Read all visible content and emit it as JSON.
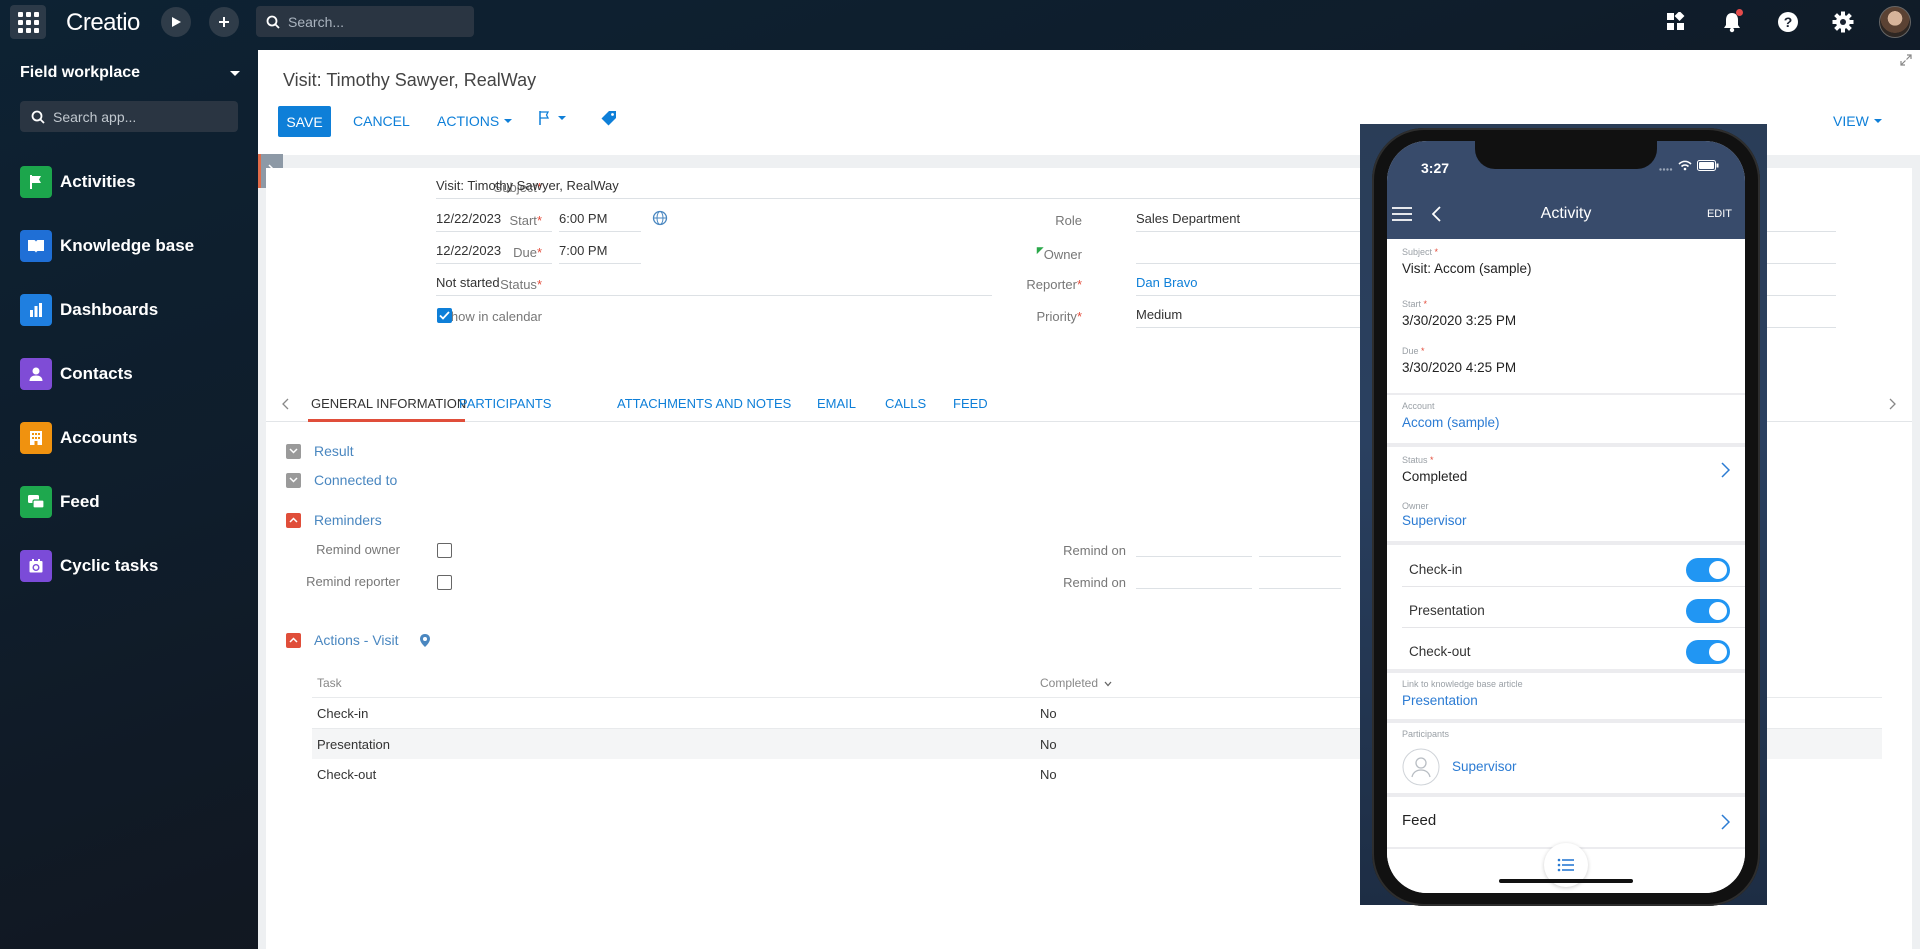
{
  "topbar": {
    "logo": "Creatio",
    "search_placeholder": "Search..."
  },
  "sidebar": {
    "workspace": "Field workplace",
    "search_placeholder": "Search app...",
    "items": [
      {
        "label": "Activities",
        "color": "#1ca64c"
      },
      {
        "label": "Knowledge base",
        "color": "#1f6fd6"
      },
      {
        "label": "Dashboards",
        "color": "#1f7fe0"
      },
      {
        "label": "Contacts",
        "color": "#7f4cd6"
      },
      {
        "label": "Accounts",
        "color": "#f0920f"
      },
      {
        "label": "Feed",
        "color": "#1ea84e"
      },
      {
        "label": "Cyclic tasks",
        "color": "#7b4bd8"
      }
    ]
  },
  "page": {
    "title": "Visit: Timothy Sawyer, RealWay",
    "save": "SAVE",
    "cancel": "CANCEL",
    "actions": "ACTIONS",
    "view": "VIEW"
  },
  "form": {
    "subject_label": "Subject",
    "subject": "Visit: Timothy Sawyer, RealWay",
    "start_label": "Start",
    "start_date": "12/22/2023",
    "start_time": "6:00 PM",
    "due_label": "Due",
    "due_date": "12/22/2023",
    "due_time": "7:00 PM",
    "status_label": "Status",
    "status": "Not started",
    "show_in_calendar_label": "Show in calendar",
    "role_label": "Role",
    "role": "Sales Department",
    "owner_label": "Owner",
    "owner": "",
    "reporter_label": "Reporter",
    "reporter": "Dan Bravo",
    "priority_label": "Priority",
    "priority": "Medium"
  },
  "tabs": [
    "GENERAL INFORMATION",
    "PARTICIPANTS",
    "ATTACHMENTS AND NOTES",
    "EMAIL",
    "CALLS",
    "FEED"
  ],
  "groups": {
    "result": "Result",
    "connected_to": "Connected to",
    "reminders": "Reminders",
    "remind_owner": "Remind owner",
    "remind_reporter": "Remind reporter",
    "remind_on": "Remind on",
    "actions_visit": "Actions - Visit"
  },
  "tasks": {
    "col_task": "Task",
    "col_completed": "Completed",
    "rows": [
      {
        "task": "Check-in",
        "completed": "No"
      },
      {
        "task": "Presentation",
        "completed": "No"
      },
      {
        "task": "Check-out",
        "completed": "No"
      }
    ]
  },
  "phone": {
    "time": "3:27",
    "title": "Activity",
    "edit": "EDIT",
    "subject_label": "Subject",
    "subject": "Visit: Accom (sample)",
    "start_label": "Start",
    "start": "3/30/2020 3:25 PM",
    "due_label": "Due",
    "due": "3/30/2020 4:25 PM",
    "account_label": "Account",
    "account": "Accom (sample)",
    "status_label": "Status",
    "status": "Completed",
    "owner_label": "Owner",
    "owner": "Supervisor",
    "toggles": [
      "Check-in",
      "Presentation",
      "Check-out"
    ],
    "kb_label": "Link to knowledge base article",
    "kb": "Presentation",
    "participants_label": "Participants",
    "participant": "Supervisor",
    "feed": "Feed"
  }
}
